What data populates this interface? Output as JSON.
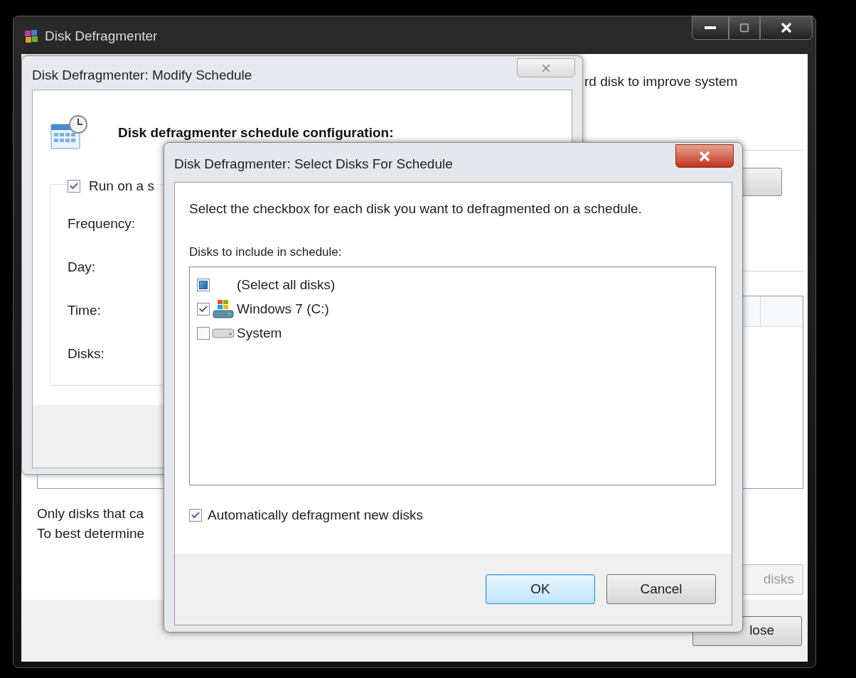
{
  "main_window": {
    "title": "Disk Defragmenter",
    "intro_fragment": "rd disk to improve system",
    "note_lines": [
      "Only disks that ca",
      "To best determine"
    ],
    "disks_button": "disks",
    "close_button": "lose"
  },
  "modify_dialog": {
    "title": "Disk Defragmenter: Modify Schedule",
    "heading": "Disk defragmenter schedule configuration:",
    "run_checkbox": {
      "label": "Run on a s",
      "checked": true
    },
    "labels": [
      "Frequency:",
      "Day:",
      "Time:",
      "Disks:"
    ]
  },
  "select_dialog": {
    "title": "Disk Defragmenter: Select Disks For Schedule",
    "instruction": "Select the checkbox for each disk you want to defragmented on a schedule.",
    "list_label": "Disks to include in schedule:",
    "disks": [
      {
        "kind": "all",
        "label": "(Select all disks)",
        "checked": false,
        "mixed": true
      },
      {
        "kind": "system_drive",
        "label": "Windows 7 (C:)",
        "checked": true,
        "mixed": false
      },
      {
        "kind": "drive",
        "label": "System",
        "checked": false,
        "mixed": false
      }
    ],
    "auto_checkbox": {
      "label": "Automatically defragment new disks",
      "checked": true
    },
    "buttons": [
      {
        "label": "OK",
        "selected": true
      },
      {
        "label": "Cancel",
        "selected": false
      }
    ]
  }
}
